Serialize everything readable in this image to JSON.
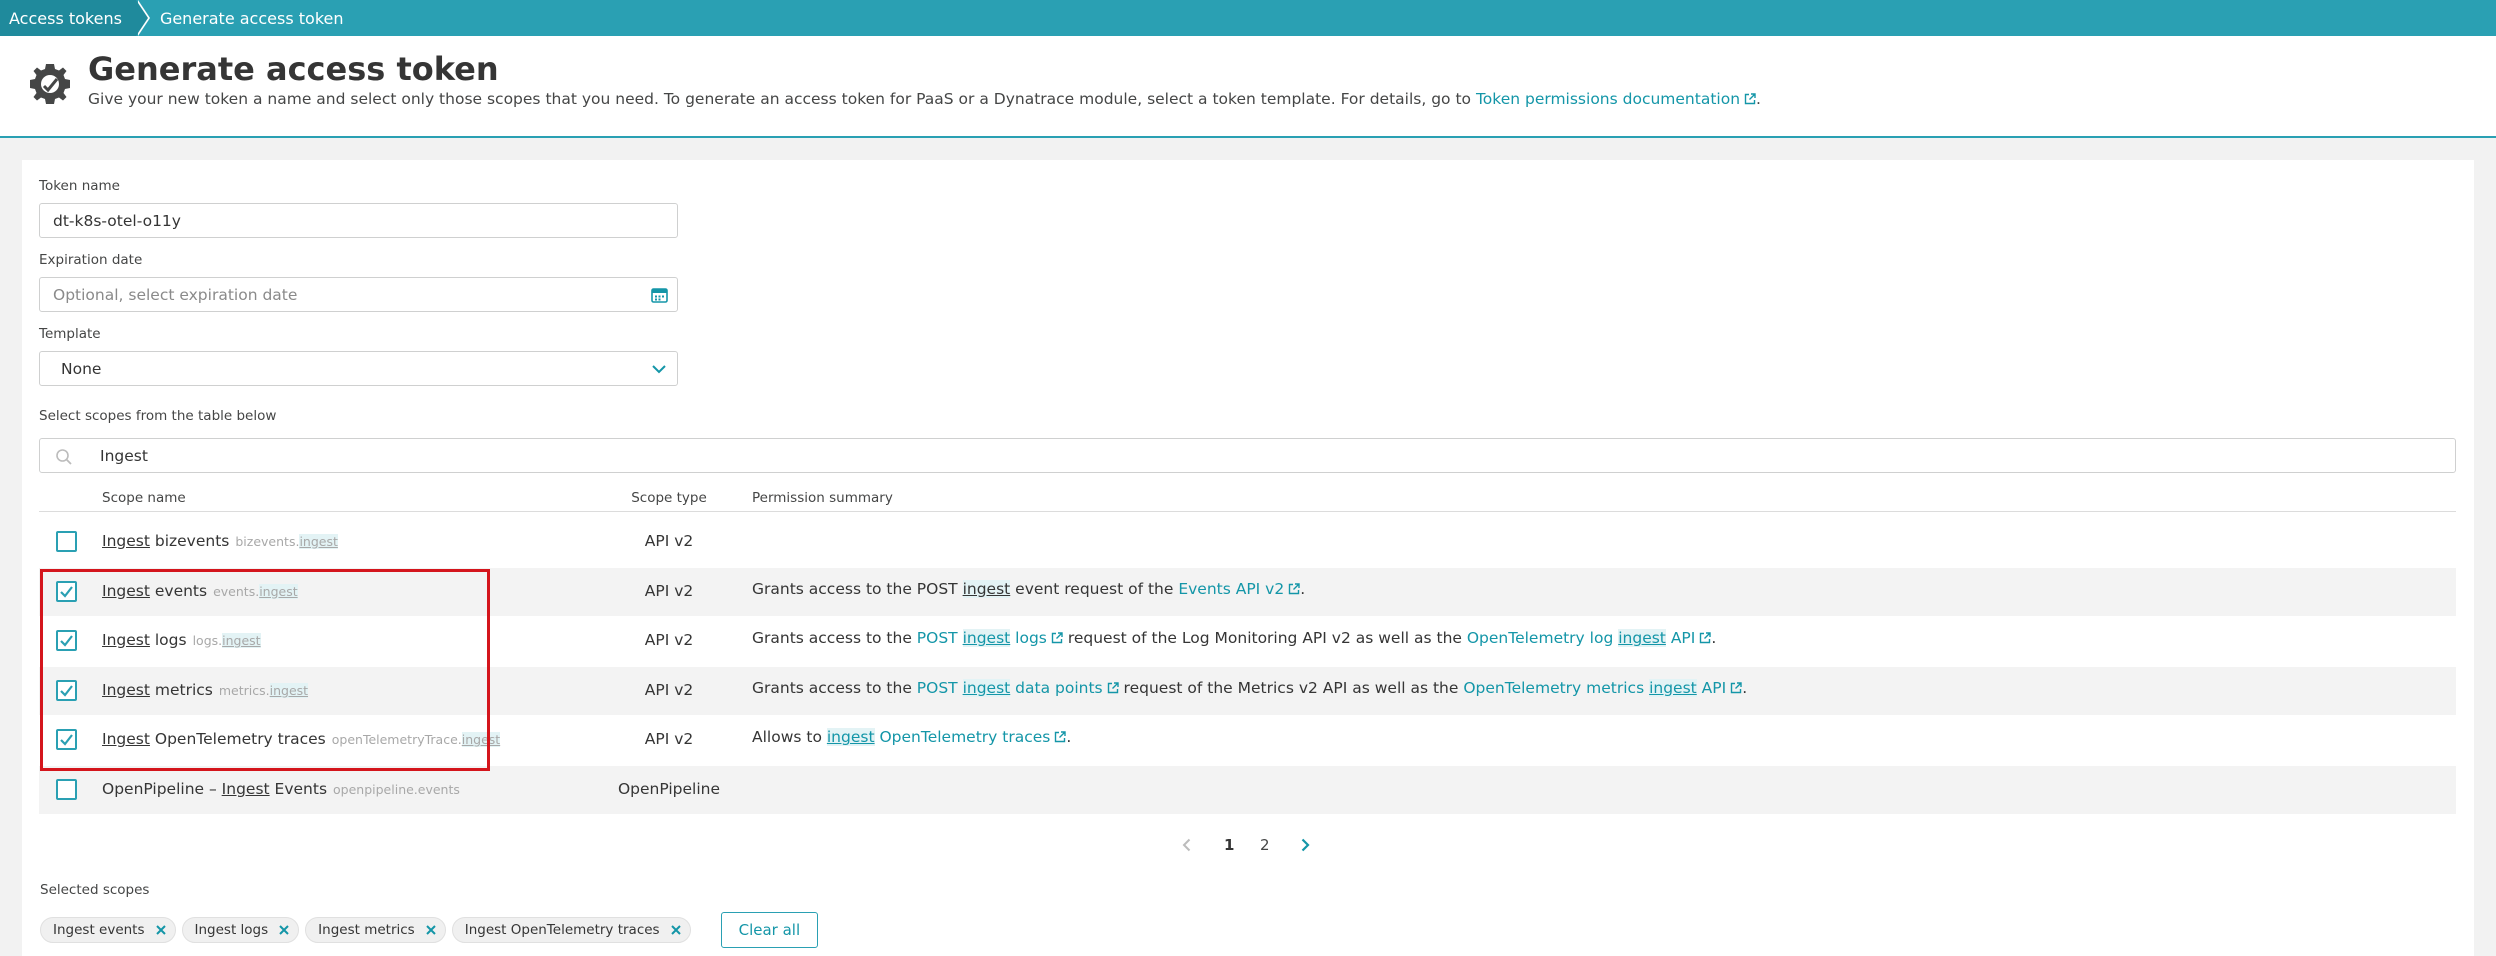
{
  "breadcrumb": {
    "items": [
      "Access tokens",
      "Generate access token"
    ]
  },
  "header": {
    "title": "Generate access token",
    "description_prefix": "Give your new token a name and select only those scopes that you need. To generate an access token for PaaS or a Dynatrace module, select a token template. For details, go to ",
    "description_link": "Token permissions documentation",
    "description_suffix": "."
  },
  "form": {
    "token_name": {
      "label": "Token name",
      "value": "dt-k8s-otel-o11y"
    },
    "expiration": {
      "label": "Expiration date",
      "placeholder": "Optional, select expiration date"
    },
    "template": {
      "label": "Template",
      "value": "None"
    },
    "scopes_label": "Select scopes from the table below",
    "search_value": "Ingest"
  },
  "table": {
    "headers": {
      "name": "Scope name",
      "type": "Scope type",
      "perm": "Permission summary"
    },
    "rows": [
      {
        "checked": false,
        "name_prefix": "",
        "name_hl": "Ingest",
        "name_rest": " bizevents",
        "id_prefix": "bizevents.",
        "id_hl": "ingest",
        "type": "API v2",
        "perm": []
      },
      {
        "checked": true,
        "name_prefix": "",
        "name_hl": "Ingest",
        "name_rest": " events",
        "id_prefix": "events.",
        "id_hl": "ingest",
        "type": "API v2",
        "perm": [
          {
            "t": "Grants access to the POST "
          },
          {
            "t": "ingest",
            "hl": true
          },
          {
            "t": " event request of the "
          },
          {
            "t": "Events API v2",
            "link": true,
            "ext": true
          },
          {
            "t": "."
          }
        ]
      },
      {
        "checked": true,
        "name_prefix": "",
        "name_hl": "Ingest",
        "name_rest": " logs",
        "id_prefix": "logs.",
        "id_hl": "ingest",
        "type": "API v2",
        "perm": [
          {
            "t": "Grants access to the "
          },
          {
            "t": "POST ",
            "link": true
          },
          {
            "t": "ingest",
            "link": true,
            "hl": true
          },
          {
            "t": " logs",
            "link": true,
            "ext": true
          },
          {
            "t": " request of the Log Monitoring API v2 as well as the "
          },
          {
            "t": "OpenTelemetry log ",
            "link": true
          },
          {
            "t": "ingest",
            "link": true,
            "hl": true
          },
          {
            "t": " API",
            "link": true,
            "ext": true
          },
          {
            "t": "."
          }
        ]
      },
      {
        "checked": true,
        "name_prefix": "",
        "name_hl": "Ingest",
        "name_rest": " metrics",
        "id_prefix": "metrics.",
        "id_hl": "ingest",
        "type": "API v2",
        "perm": [
          {
            "t": "Grants access to the "
          },
          {
            "t": "POST ",
            "link": true
          },
          {
            "t": "ingest",
            "link": true,
            "hl": true
          },
          {
            "t": " data points",
            "link": true,
            "ext": true
          },
          {
            "t": " request of the Metrics v2 API as well as the "
          },
          {
            "t": "OpenTelemetry metrics ",
            "link": true
          },
          {
            "t": "ingest",
            "link": true,
            "hl": true
          },
          {
            "t": " API",
            "link": true,
            "ext": true
          },
          {
            "t": "."
          }
        ]
      },
      {
        "checked": true,
        "name_prefix": "",
        "name_hl": "Ingest",
        "name_rest": " OpenTelemetry traces",
        "id_prefix": "openTelemetryTrace.",
        "id_hl": "ingest",
        "type": "API v2",
        "perm": [
          {
            "t": "Allows to "
          },
          {
            "t": "ingest",
            "link": true,
            "hl": true
          },
          {
            "t": " OpenTelemetry traces",
            "link": true,
            "ext": true
          },
          {
            "t": "."
          }
        ]
      },
      {
        "checked": false,
        "name_prefix": "OpenPipeline – ",
        "name_hl": "Ingest",
        "name_rest": " Events",
        "id_prefix": "openpipeline.events",
        "id_hl": "",
        "type": "OpenPipeline",
        "perm": []
      }
    ]
  },
  "pagination": {
    "page1": "1",
    "page2": "2"
  },
  "selected": {
    "label": "Selected scopes",
    "chips": [
      "Ingest events",
      "Ingest logs",
      "Ingest metrics",
      "Ingest OpenTelemetry traces"
    ],
    "clear_label": "Clear all"
  },
  "colors": {
    "accent": "#2aa0b3",
    "link": "#1496a8",
    "highlight_box": "#d4151c"
  }
}
